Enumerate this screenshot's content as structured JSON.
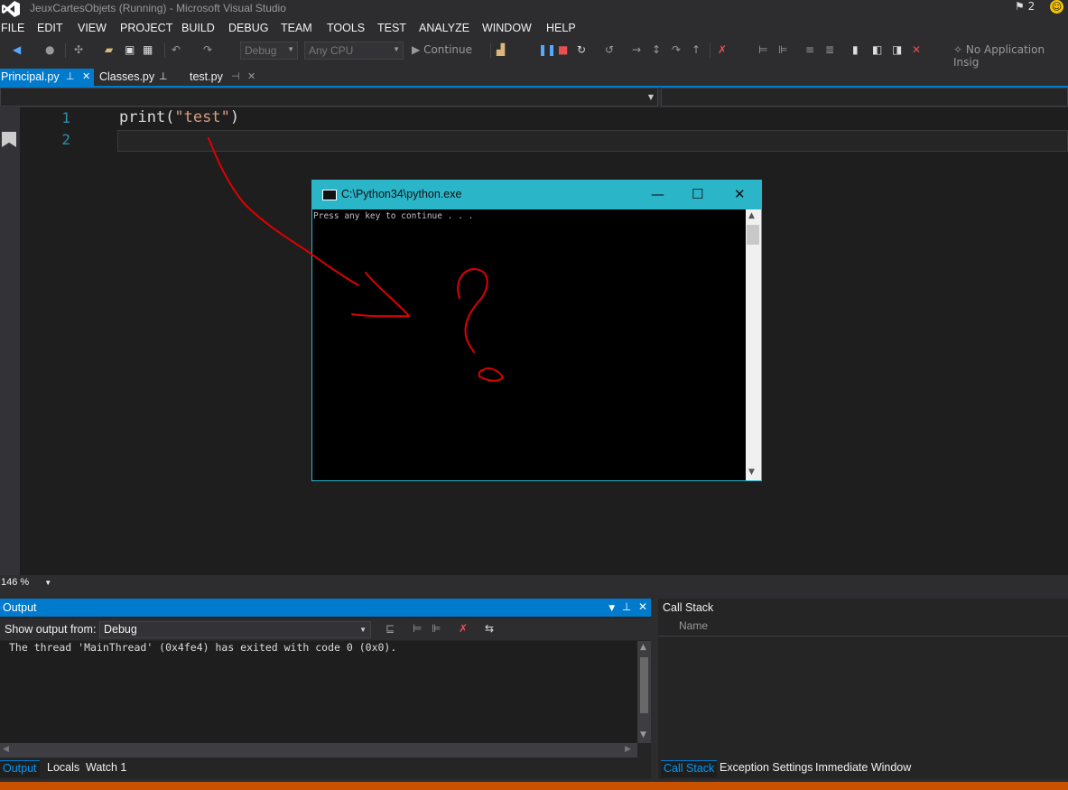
{
  "window": {
    "title": "JeuxCartesObjets (Running) - Microsoft Visual Studio",
    "notification_count": "2"
  },
  "menu": [
    "FILE",
    "EDIT",
    "VIEW",
    "PROJECT",
    "BUILD",
    "DEBUG",
    "TEAM",
    "TOOLS",
    "TEST",
    "ANALYZE",
    "WINDOW",
    "HELP"
  ],
  "toolbar": {
    "config": "Debug",
    "platform": "Any CPU",
    "continue_label": "Continue",
    "insights_label": "No Application Insig"
  },
  "tabs": [
    {
      "label": "Principal.py",
      "active": true
    },
    {
      "label": "Classes.py",
      "active": false
    },
    {
      "label": "test.py",
      "active": false
    }
  ],
  "editor": {
    "lines": [
      {
        "number": "1",
        "code_prefix": "print(",
        "code_string": "\"test\"",
        "code_suffix": ")"
      },
      {
        "number": "2",
        "code_prefix": "",
        "code_string": "",
        "code_suffix": ""
      }
    ],
    "zoom": "146 %"
  },
  "console": {
    "title": "C:\\Python34\\python.exe",
    "text": "Press any key to continue . . .",
    "minimize": "—",
    "maximize": "☐",
    "close": "✕"
  },
  "output": {
    "title": "Output",
    "show_from_label": "Show output from:",
    "source": "Debug",
    "text": "The thread 'MainThread' (0x4fe4) has exited with code 0 (0x0)."
  },
  "callstack": {
    "title": "Call Stack",
    "column_name": "Name"
  },
  "bottom_tabs_left": [
    {
      "label": "Output",
      "active": true
    },
    {
      "label": "Locals",
      "active": false
    },
    {
      "label": "Watch 1",
      "active": false
    }
  ],
  "bottom_tabs_right": [
    {
      "label": "Call Stack",
      "active": true
    },
    {
      "label": "Exception Settings",
      "active": false
    },
    {
      "label": "Immediate Window",
      "active": false
    }
  ],
  "colors": {
    "accent": "#007acc",
    "console_title": "#2bb5c8",
    "annotation": "#e00000",
    "status": "#ca5100"
  }
}
